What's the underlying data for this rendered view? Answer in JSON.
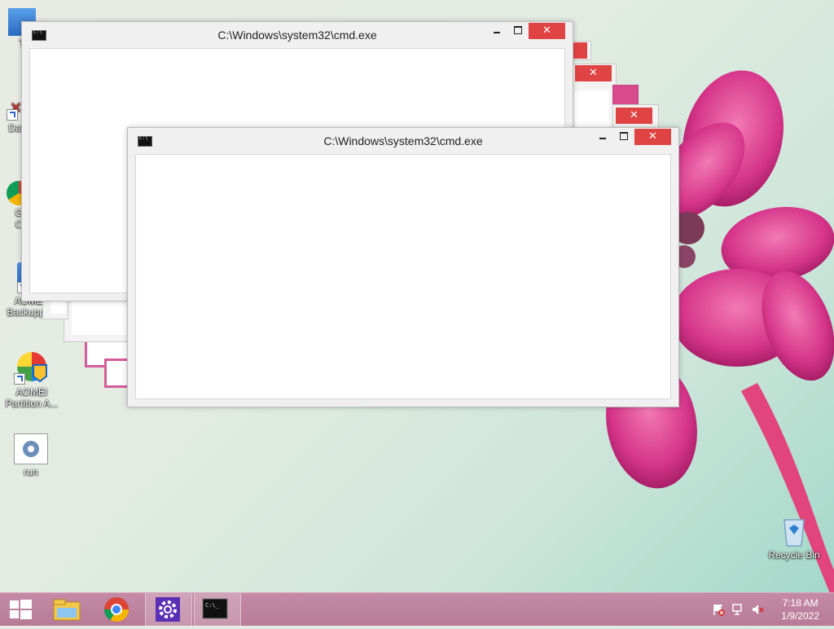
{
  "desktop": {
    "icons": [
      {
        "label": "T"
      },
      {
        "label": "Data"
      },
      {
        "label": "G\nC"
      },
      {
        "label": "AOMEI Backupper"
      },
      {
        "label": "AOMEI Partition A..."
      },
      {
        "label": "run"
      },
      {
        "label": "Recycle Bin"
      }
    ]
  },
  "windows": {
    "back_title": "C:\\Windows\\system32\\cmd.exe",
    "front_title": "C:\\Windows\\system32\\cmd.exe",
    "close_glyph": "✕"
  },
  "taskbar": {
    "items": [
      "start-button",
      "file-explorer",
      "chrome",
      "settings",
      "command-prompt"
    ],
    "time": "7:18 AM",
    "date": "1/9/2022"
  },
  "colors": {
    "accent_close": "#e04343",
    "taskbar": "#b77b98",
    "flower": "#d63c8a"
  }
}
